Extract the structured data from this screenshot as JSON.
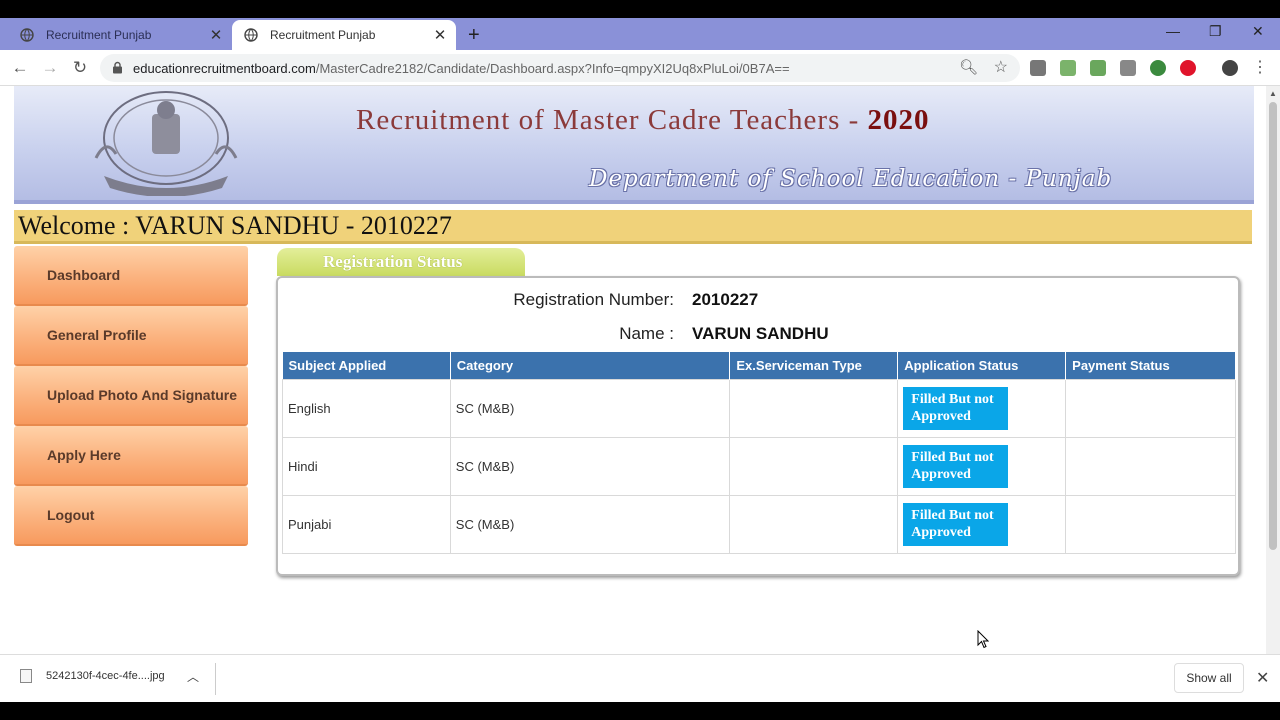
{
  "browser": {
    "tabs": [
      {
        "title": "Recruitment Punjab",
        "active": false
      },
      {
        "title": "Recruitment Punjab",
        "active": true
      }
    ],
    "url_host": "educationrecruitmentboard.com",
    "url_path": "/MasterCadre2182/Candidate/Dashboard.aspx?Info=qmpyXI2Uq8xPluLoi/0B7A=="
  },
  "banner": {
    "title": "Recruitment of Master Cadre Teachers - ",
    "year": "2020",
    "subtitle": "Department of School Education - Punjab"
  },
  "welcome": "Welcome : VARUN SANDHU - 2010227",
  "sidebar": {
    "items": [
      {
        "label": "Dashboard"
      },
      {
        "label": "General Profile"
      },
      {
        "label": "Upload Photo And Signature"
      },
      {
        "label": "Apply Here"
      },
      {
        "label": "Logout"
      }
    ]
  },
  "panel": {
    "tab_label": "Registration Status",
    "reg_label": "Registration Number:",
    "reg_value": "2010227",
    "name_label": "Name :",
    "name_value": "VARUN SANDHU",
    "columns": [
      "Subject Applied",
      "Category",
      "Ex.Serviceman Type",
      "Application Status",
      "Payment Status"
    ],
    "rows": [
      {
        "subject": "English",
        "category": "SC (M&B)",
        "ex_serviceman": "",
        "application_status": "Filled But not Approved",
        "payment_status": ""
      },
      {
        "subject": "Hindi",
        "category": "SC (M&B)",
        "ex_serviceman": "",
        "application_status": "Filled But not Approved",
        "payment_status": ""
      },
      {
        "subject": "Punjabi",
        "category": "SC (M&B)",
        "ex_serviceman": "",
        "application_status": "Filled But not Approved",
        "payment_status": ""
      }
    ]
  },
  "downloads": {
    "file": "5242130f-4cec-4fe....jpg",
    "show_all": "Show all"
  },
  "colors": {
    "tabstrip": "#8a91d8",
    "welcome_bar": "#f0d27a",
    "sidebar_item": "#fbb27e",
    "table_header": "#3b72ad",
    "status_badge": "#0aa6e8"
  }
}
